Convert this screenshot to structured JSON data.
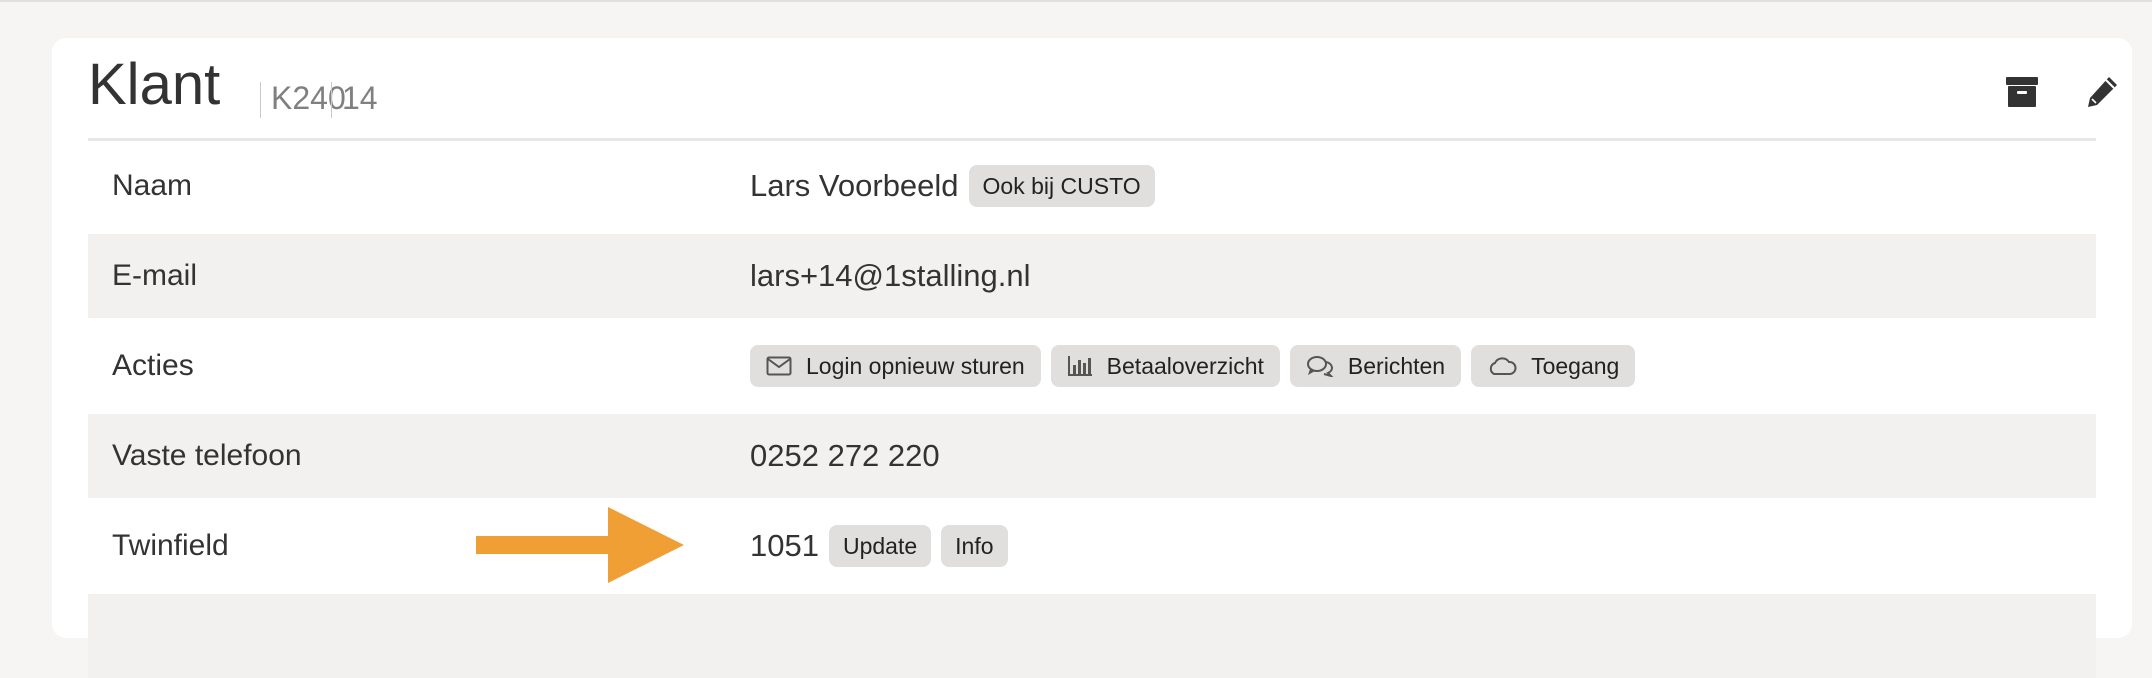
{
  "header": {
    "title": "Klant",
    "code": "K240",
    "number": "14",
    "archive_icon": "archive-box-icon",
    "edit_icon": "pencil-icon"
  },
  "rows": {
    "name": {
      "label": "Naam",
      "value": "Lars Voorbeeld",
      "badge": "Ook bij CUSTO"
    },
    "email": {
      "label": "E-mail",
      "value": "lars+14@1stalling.nl"
    },
    "actions": {
      "label": "Acties",
      "buttons": [
        {
          "label": "Login opnieuw sturen",
          "icon": "envelope-icon"
        },
        {
          "label": "Betaaloverzicht",
          "icon": "bar-chart-icon"
        },
        {
          "label": "Berichten",
          "icon": "chat-bubbles-icon"
        },
        {
          "label": "Toegang",
          "icon": "cloud-icon"
        }
      ]
    },
    "phone": {
      "label": "Vaste telefoon",
      "value": "0252 272 220"
    },
    "twinfield": {
      "label": "Twinfield",
      "value": "1051",
      "update_label": "Update",
      "info_label": "Info"
    }
  },
  "colors": {
    "row_shaded": "#f2f1ef",
    "pill_bg": "#e0dfdd",
    "arrow": "#ef9f33",
    "text": "#333333"
  }
}
